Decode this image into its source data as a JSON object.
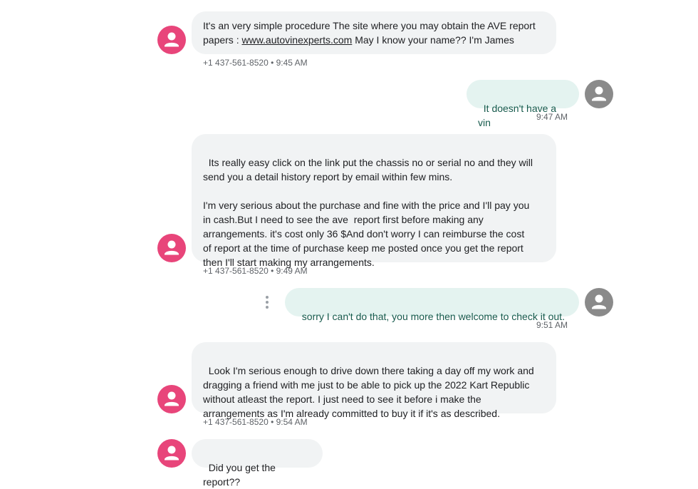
{
  "colors": {
    "contact_avatar": "#e8457a",
    "self_avatar": "#8a8a8a",
    "incoming_bubble": "#f1f3f4",
    "outgoing_bubble": "#e4f3f0",
    "outgoing_text": "#165a4c"
  },
  "icons": {
    "contact_avatar": "person-icon",
    "self_avatar": "person-icon",
    "message_options": "more-vertical-icon"
  },
  "messages": [
    {
      "text_before_link": "It's an very simple procedure The site where you may obtain the AVE report\npapers : ",
      "link": "www.autovinexperts.com",
      "text_after_link": " May I know your name?? I'm James",
      "meta": "+1 437-561-8520 • 9:45 AM"
    },
    {
      "text": "It doesn't have a vin",
      "meta": "9:47 AM"
    },
    {
      "text": "Its really easy click on the link put the chassis no or serial no and they will\nsend you a detail history report by email within few mins.\n\nI'm very serious about the purchase and fine with the price and I'll pay you\nin cash.But I need to see the ave  report first before making any\narrangements. it's cost only 36 $And don't worry I can reimburse the cost\nof report at the time of purchase keep me posted once you get the report\nthen I'll start making my arrangements.",
      "meta": "+1 437-561-8520 • 9:49 AM"
    },
    {
      "text": "sorry I can't do that, you more then welcome to check it out.",
      "meta": "9:51 AM"
    },
    {
      "text": "Look I'm serious enough to drive down there taking a day off my work and\ndragging a friend with me just to be able to pick up the 2022 Kart Republic\nwithout atleast the report. I just need to see it before i make the\narrangements as I'm already committed to buy it if it's as described.",
      "meta": "+1 437-561-8520 • 9:54 AM"
    },
    {
      "text": "Did you get the report??"
    }
  ]
}
